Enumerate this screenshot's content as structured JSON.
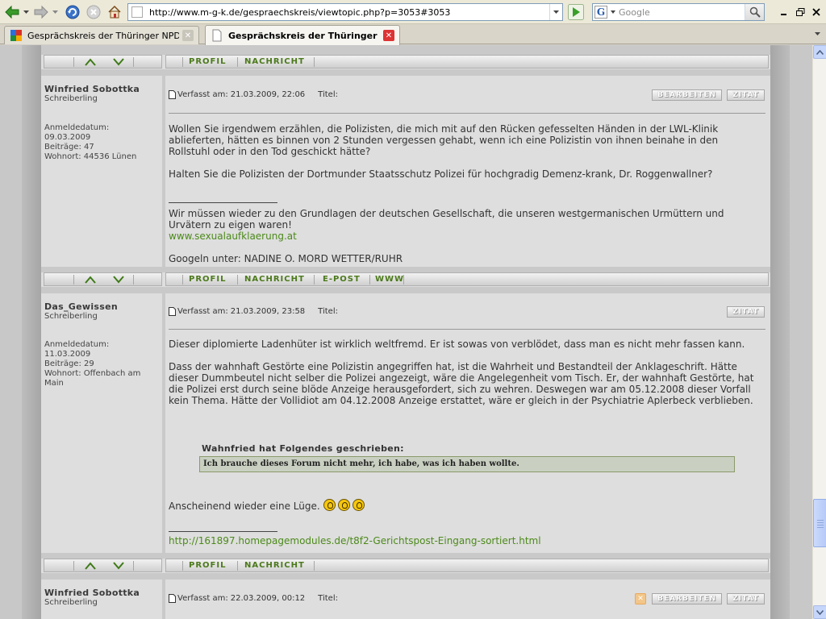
{
  "browser": {
    "url": "http://www.m-g-k.de/gespraechskreis/viewtopic.php?p=3053#3053",
    "search_placeholder": "Google",
    "tabs": [
      {
        "label": "Gesprächskreis der Thüringer NPD :: T..."
      },
      {
        "label": "Gesprächskreis der Thüringer NP..."
      }
    ]
  },
  "bar_links": {
    "profil": "PROFIL",
    "nachricht": "NACHRICHT",
    "epost": "E-POST",
    "www": "WWW"
  },
  "buttons": {
    "bearbeiten": "BEARBEITEN",
    "zitat": "ZITAT"
  },
  "labels": {
    "written": "Verfasst am:",
    "title": "Titel:"
  },
  "posts": [
    {
      "author": "Winfried Sobottka",
      "rank": "Schreiberling",
      "info": [
        "Anmeldedatum:",
        "09.03.2009",
        "Beiträge: 47",
        "Wohnort: 44536 Lünen"
      ],
      "date": "21.03.2009, 22:06",
      "body": [
        "Wollen Sie irgendwem erzählen, die Polizisten, die mich mit auf den Rücken gefesselten Händen in der LWL-Klinik ablieferten, hätten es binnen von 2 Stunden vergessen gehabt, wenn ich eine Polizistin von ihnen beinahe in den Rollstuhl oder in den Tod geschickt hätte?",
        "Halten Sie die Polizisten der Dortmunder Staatsschutz Polizei für hochgradig Demenz-krank, Dr. Roggenwallner?"
      ],
      "signature": [
        "Wir müssen wieder zu den Grundlagen der deutschen Gesellschaft, die unseren westgermanischen Urmüttern und Urvätern zu eigen waren!",
        "www.sexualaufklaerung.at",
        "Googeln unter: NADINE O. MORD WETTER/RUHR"
      ]
    },
    {
      "author": "Das_Gewissen",
      "rank": "Schreiberling",
      "info": [
        "Anmeldedatum:",
        "11.03.2009",
        "Beiträge: 29",
        "Wohnort: Offenbach am Main"
      ],
      "date": "21.03.2009, 23:58",
      "body": [
        "Dieser diplomierte Ladenhüter ist wirklich weltfremd. Er ist sowas von verblödet, dass man es nicht mehr fassen kann.",
        "Dass der wahnhaft Gestörte eine Polizistin angegriffen hat, ist die Wahrheit und Bestandteil der Anklageschrift. Hätte dieser Dummbeutel nicht selber die Polizei angezeigt, wäre die Angelegenheit vom Tisch. Er, der wahnhaft Gestörte, hat die Polizei erst durch seine blöde Anzeige herausgefordert, sich zu wehren. Deswegen war am 05.12.2008 dieser Vorfall kein Thema. Hätte der Vollidiot am 04.12.2008 Anzeige erstattet, wäre er gleich in der Psychiatrie Aplerbeck verblieben."
      ],
      "quote_author": "Wahnfried hat Folgendes geschrieben:",
      "quote_text": "Ich brauche dieses Forum nicht mehr, ich habe, was ich haben wollte.",
      "after_quote": "Anscheinend wieder eine Lüge.",
      "signature_link": "http://161897.homepagemodules.de/t8f2-Gerichtspost-Eingang-sortiert.html"
    },
    {
      "author": "Winfried Sobottka",
      "rank": "Schreiberling",
      "date": "22.03.2009, 00:12"
    }
  ]
}
